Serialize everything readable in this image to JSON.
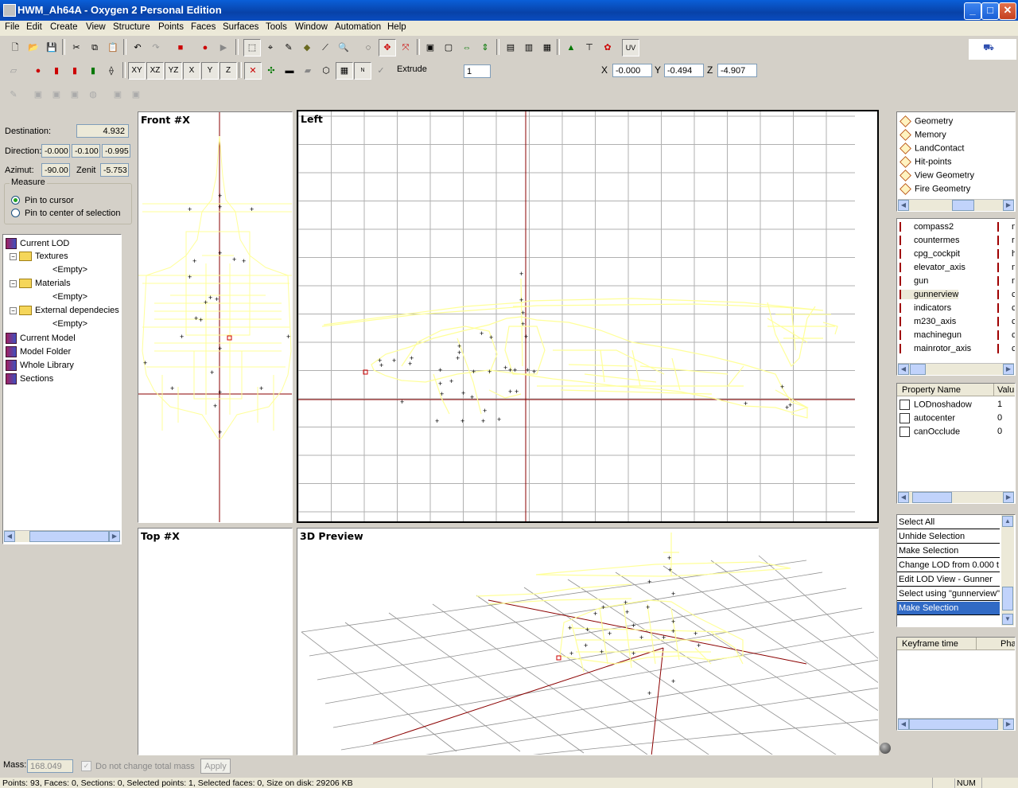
{
  "window": {
    "title": "HWM_Ah64A - Oxygen 2 Personal Edition"
  },
  "menu": [
    "File",
    "Edit",
    "Create",
    "View",
    "Structure",
    "Points",
    "Faces",
    "Surfaces",
    "Tools",
    "Window",
    "Automation",
    "Help"
  ],
  "toolbar": {
    "axis_buttons": [
      "XY",
      "XZ",
      "YZ",
      "X",
      "Y",
      "Z"
    ],
    "uv_label": "UV",
    "extrude_label": "Extrude",
    "extrude_value": "1",
    "coord_x_label": "X",
    "coord_x": "-0.000",
    "coord_y_label": "Y",
    "coord_y": "-0.494",
    "coord_z_label": "Z",
    "coord_z": "-4.907"
  },
  "measure": {
    "destination_label": "Destination:",
    "destination": "4.932",
    "direction_label": "Direction:",
    "direction": [
      "-0.000",
      "-0.100",
      "-0.995"
    ],
    "azimut_label": "Azimut:",
    "azimut": "-90.00",
    "zenit_label": "Zenit",
    "zenit": "-5.753",
    "group_label": "Measure",
    "option_cursor": "Pin to cursor",
    "option_center": "Pin to center of selection"
  },
  "tree": {
    "current_lod": "Current LOD",
    "textures": "Textures",
    "materials": "Materials",
    "external": "External dependecies",
    "empty": "<Empty>",
    "current_model": "Current Model",
    "model_folder": "Model Folder",
    "whole_library": "Whole Library",
    "sections": "Sections"
  },
  "viewports": {
    "front": "Front #X",
    "left": "Left",
    "top": "Top #X",
    "preview": "3D Preview"
  },
  "lods": [
    "Geometry",
    "Memory",
    "LandContact",
    "Hit-points",
    "View Geometry",
    "Fire Geometry"
  ],
  "selections": [
    "compass2",
    "countermes",
    "cpg_cockpit",
    "elevator_axis",
    "gun",
    "gunnerview",
    "indicators",
    "m230_axis",
    "machinegun",
    "mainrotor_axis"
  ],
  "selections_col2": [
    "n",
    "r",
    "h",
    "n",
    "n",
    "c",
    "c",
    "c",
    "c",
    "c"
  ],
  "properties": {
    "col_name": "Property Name",
    "col_value": "Valu",
    "rows": [
      {
        "name": "LODnoshadow",
        "value": "1"
      },
      {
        "name": "autocenter",
        "value": "0"
      },
      {
        "name": "canOcclude",
        "value": "0"
      }
    ]
  },
  "history": [
    "Select All",
    "Unhide Selection",
    "Make Selection",
    "Change LOD from   0.000 t",
    "Edit LOD View - Gunner",
    "Select using \"gunnerview\"",
    "Make Selection"
  ],
  "keyframes": {
    "col_time": "Keyframe time",
    "col_phase": "Phase"
  },
  "mass": {
    "label": "Mass:",
    "value": "168.049",
    "checkbox": "Do not change total mass",
    "apply": "Apply"
  },
  "status": {
    "text": "Points: 93, Faces: 0, Sections: 0, Selected points: 1, Selected faces: 0, Size on disk: 29206 KB",
    "num": "NUM"
  },
  "colors": {
    "accent": "#0a246a",
    "wire": "#ffff99",
    "grid": "#b0b0b0",
    "axis": "#8b0000"
  }
}
